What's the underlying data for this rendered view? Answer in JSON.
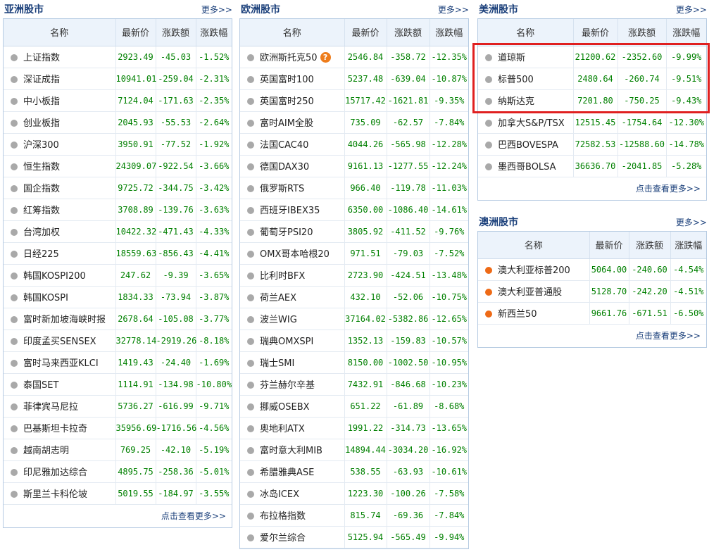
{
  "headers": [
    "名称",
    "最新价",
    "涨跌额",
    "涨跌幅"
  ],
  "asia": {
    "title": "亚洲股市",
    "more": "更多>>",
    "footer": "点击查看更多>>",
    "rows": [
      {
        "name": "上证指数",
        "price": "2923.49",
        "chg": "-45.03",
        "pct": "-1.52%"
      },
      {
        "name": "深证成指",
        "price": "10941.01",
        "chg": "-259.04",
        "pct": "-2.31%"
      },
      {
        "name": "中小板指",
        "price": "7124.04",
        "chg": "-171.63",
        "pct": "-2.35%"
      },
      {
        "name": "创业板指",
        "price": "2045.93",
        "chg": "-55.53",
        "pct": "-2.64%"
      },
      {
        "name": "沪深300",
        "price": "3950.91",
        "chg": "-77.52",
        "pct": "-1.92%"
      },
      {
        "name": "恒生指数",
        "price": "24309.07",
        "chg": "-922.54",
        "pct": "-3.66%"
      },
      {
        "name": "国企指数",
        "price": "9725.72",
        "chg": "-344.75",
        "pct": "-3.42%"
      },
      {
        "name": "红筹指数",
        "price": "3708.89",
        "chg": "-139.76",
        "pct": "-3.63%"
      },
      {
        "name": "台湾加权",
        "price": "10422.32",
        "chg": "-471.43",
        "pct": "-4.33%"
      },
      {
        "name": "日经225",
        "price": "18559.63",
        "chg": "-856.43",
        "pct": "-4.41%"
      },
      {
        "name": "韩国KOSPI200",
        "price": "247.62",
        "chg": "-9.39",
        "pct": "-3.65%"
      },
      {
        "name": "韩国KOSPI",
        "price": "1834.33",
        "chg": "-73.94",
        "pct": "-3.87%"
      },
      {
        "name": "富时新加坡海峡时报",
        "price": "2678.64",
        "chg": "-105.08",
        "pct": "-3.77%"
      },
      {
        "name": "印度孟买SENSEX",
        "price": "32778.14",
        "chg": "-2919.26",
        "pct": "-8.18%"
      },
      {
        "name": "富时马来西亚KLCI",
        "price": "1419.43",
        "chg": "-24.40",
        "pct": "-1.69%"
      },
      {
        "name": "泰国SET",
        "price": "1114.91",
        "chg": "-134.98",
        "pct": "-10.80%"
      },
      {
        "name": "菲律宾马尼拉",
        "price": "5736.27",
        "chg": "-616.99",
        "pct": "-9.71%"
      },
      {
        "name": "巴基斯坦卡拉奇",
        "price": "35956.69",
        "chg": "-1716.56",
        "pct": "-4.56%"
      },
      {
        "name": "越南胡志明",
        "price": "769.25",
        "chg": "-42.10",
        "pct": "-5.19%"
      },
      {
        "name": "印尼雅加达综合",
        "price": "4895.75",
        "chg": "-258.36",
        "pct": "-5.01%"
      },
      {
        "name": "斯里兰卡科伦坡",
        "price": "5019.55",
        "chg": "-184.97",
        "pct": "-3.55%"
      }
    ]
  },
  "europe": {
    "title": "欧洲股市",
    "more": "更多>>",
    "question_icon": "?",
    "rows": [
      {
        "name": "欧洲斯托克50",
        "price": "2546.84",
        "chg": "-358.72",
        "pct": "-12.35%"
      },
      {
        "name": "英国富时100",
        "price": "5237.48",
        "chg": "-639.04",
        "pct": "-10.87%"
      },
      {
        "name": "英国富时250",
        "price": "15717.42",
        "chg": "-1621.81",
        "pct": "-9.35%"
      },
      {
        "name": "富时AIM全股",
        "price": "735.09",
        "chg": "-62.57",
        "pct": "-7.84%"
      },
      {
        "name": "法国CAC40",
        "price": "4044.26",
        "chg": "-565.98",
        "pct": "-12.28%"
      },
      {
        "name": "德国DAX30",
        "price": "9161.13",
        "chg": "-1277.55",
        "pct": "-12.24%"
      },
      {
        "name": "俄罗斯RTS",
        "price": "966.40",
        "chg": "-119.78",
        "pct": "-11.03%"
      },
      {
        "name": "西班牙IBEX35",
        "price": "6350.00",
        "chg": "-1086.40",
        "pct": "-14.61%"
      },
      {
        "name": "葡萄牙PSI20",
        "price": "3805.92",
        "chg": "-411.52",
        "pct": "-9.76%"
      },
      {
        "name": "OMX哥本哈根20",
        "price": "971.51",
        "chg": "-79.03",
        "pct": "-7.52%"
      },
      {
        "name": "比利时BFX",
        "price": "2723.90",
        "chg": "-424.51",
        "pct": "-13.48%"
      },
      {
        "name": "荷兰AEX",
        "price": "432.10",
        "chg": "-52.06",
        "pct": "-10.75%"
      },
      {
        "name": "波兰WIG",
        "price": "37164.02",
        "chg": "-5382.86",
        "pct": "-12.65%"
      },
      {
        "name": "瑞典OMXSPI",
        "price": "1352.13",
        "chg": "-159.83",
        "pct": "-10.57%"
      },
      {
        "name": "瑞士SMI",
        "price": "8150.00",
        "chg": "-1002.50",
        "pct": "-10.95%"
      },
      {
        "name": "芬兰赫尔辛基",
        "price": "7432.91",
        "chg": "-846.68",
        "pct": "-10.23%"
      },
      {
        "name": "挪威OSEBX",
        "price": "651.22",
        "chg": "-61.89",
        "pct": "-8.68%"
      },
      {
        "name": "奥地利ATX",
        "price": "1991.22",
        "chg": "-314.73",
        "pct": "-13.65%"
      },
      {
        "name": "富时意大利MIB",
        "price": "14894.44",
        "chg": "-3034.20",
        "pct": "-16.92%"
      },
      {
        "name": "希腊雅典ASE",
        "price": "538.55",
        "chg": "-63.93",
        "pct": "-10.61%"
      },
      {
        "name": "冰岛ICEX",
        "price": "1223.30",
        "chg": "-100.26",
        "pct": "-7.58%"
      },
      {
        "name": "布拉格指数",
        "price": "815.74",
        "chg": "-69.36",
        "pct": "-7.84%"
      },
      {
        "name": "爱尔兰综合",
        "price": "5125.94",
        "chg": "-565.49",
        "pct": "-9.94%"
      }
    ]
  },
  "america": {
    "title": "美洲股市",
    "more": "更多>>",
    "footer": "点击查看更多>>",
    "rows": [
      {
        "name": "道琼斯",
        "price": "21200.62",
        "chg": "-2352.60",
        "pct": "-9.99%"
      },
      {
        "name": "标普500",
        "price": "2480.64",
        "chg": "-260.74",
        "pct": "-9.51%"
      },
      {
        "name": "纳斯达克",
        "price": "7201.80",
        "chg": "-750.25",
        "pct": "-9.43%"
      },
      {
        "name": "加拿大S&P/TSX",
        "price": "12515.45",
        "chg": "-1754.64",
        "pct": "-12.30%"
      },
      {
        "name": "巴西BOVESPA",
        "price": "72582.53",
        "chg": "-12588.60",
        "pct": "-14.78%"
      },
      {
        "name": "墨西哥BOLSA",
        "price": "36636.70",
        "chg": "-2041.85",
        "pct": "-5.28%"
      }
    ]
  },
  "oceania": {
    "title": "澳洲股市",
    "more": "更多>>",
    "footer": "点击查看更多>>",
    "rows": [
      {
        "name": "澳大利亚标普200",
        "price": "5064.00",
        "chg": "-240.60",
        "pct": "-4.54%"
      },
      {
        "name": "澳大利亚普通股",
        "price": "5128.70",
        "chg": "-242.20",
        "pct": "-4.51%"
      },
      {
        "name": "新西兰50",
        "price": "9661.76",
        "chg": "-671.51",
        "pct": "-6.50%"
      }
    ]
  },
  "colors": {
    "accent": "#1a3f7a",
    "negative": "#008000",
    "highlight": "#e02020",
    "dot_gray": "#a9a9a9",
    "dot_orange": "#ee6a16"
  }
}
